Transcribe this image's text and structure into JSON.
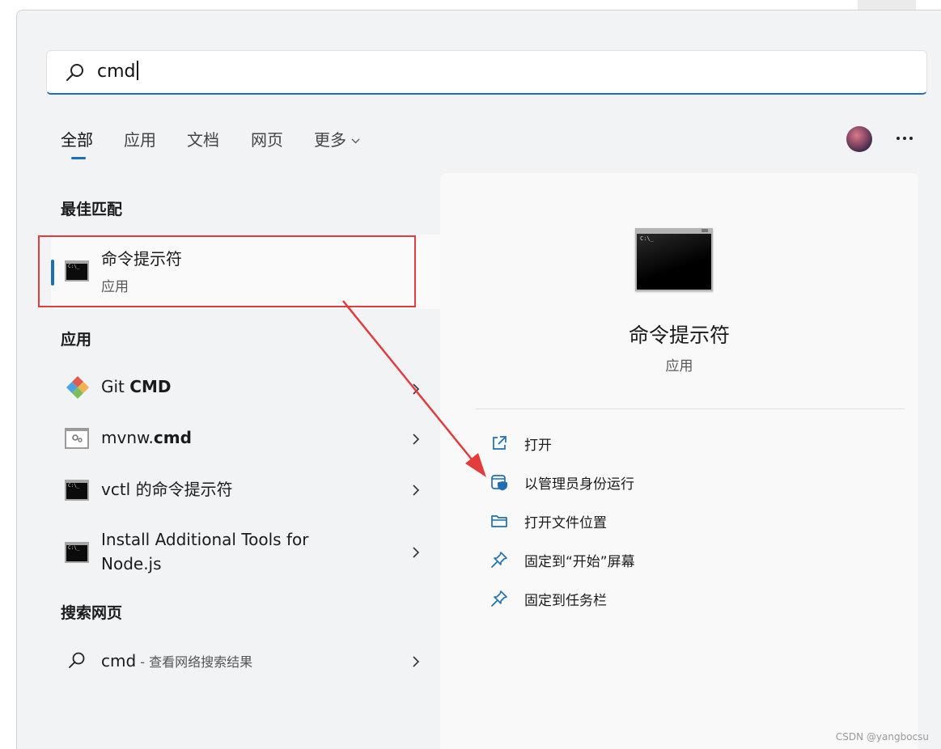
{
  "search": {
    "value": "cmd"
  },
  "tabs": [
    {
      "label": "全部"
    },
    {
      "label": "应用"
    },
    {
      "label": "文档"
    },
    {
      "label": "网页"
    },
    {
      "label": "更多"
    }
  ],
  "sections": {
    "best_match": "最佳匹配",
    "apps": "应用",
    "web": "搜索网页"
  },
  "best_match": {
    "title": "命令提示符",
    "subtitle": "应用"
  },
  "apps": [
    {
      "name_prefix": "Git ",
      "name_bold": "CMD",
      "icon": "git-icon"
    },
    {
      "name_prefix": "mvnw.",
      "name_bold": "cmd",
      "icon": "gear-icon"
    },
    {
      "name_prefix": "vctl 的命令提示符",
      "name_bold": "",
      "icon": "cmd-icon"
    },
    {
      "name_line1": "Install Additional Tools for",
      "name_line2": "Node.js",
      "icon": "cmd-icon"
    }
  ],
  "web_result": {
    "query": "cmd",
    "suffix": " - 查看网络搜索结果"
  },
  "detail": {
    "title": "命令提示符",
    "subtitle": "应用",
    "actions": [
      {
        "label": "打开",
        "icon": "open-external-icon"
      },
      {
        "label": "以管理员身份运行",
        "icon": "shield-admin-icon"
      },
      {
        "label": "打开文件位置",
        "icon": "folder-icon"
      },
      {
        "label": "固定到“开始”屏幕",
        "icon": "pin-icon"
      },
      {
        "label": "固定到任务栏",
        "icon": "pin-icon"
      }
    ]
  },
  "colors": {
    "accent": "#1f6fb5",
    "annotation": "#e23c3c"
  },
  "watermark": "CSDN @yangbocsu"
}
